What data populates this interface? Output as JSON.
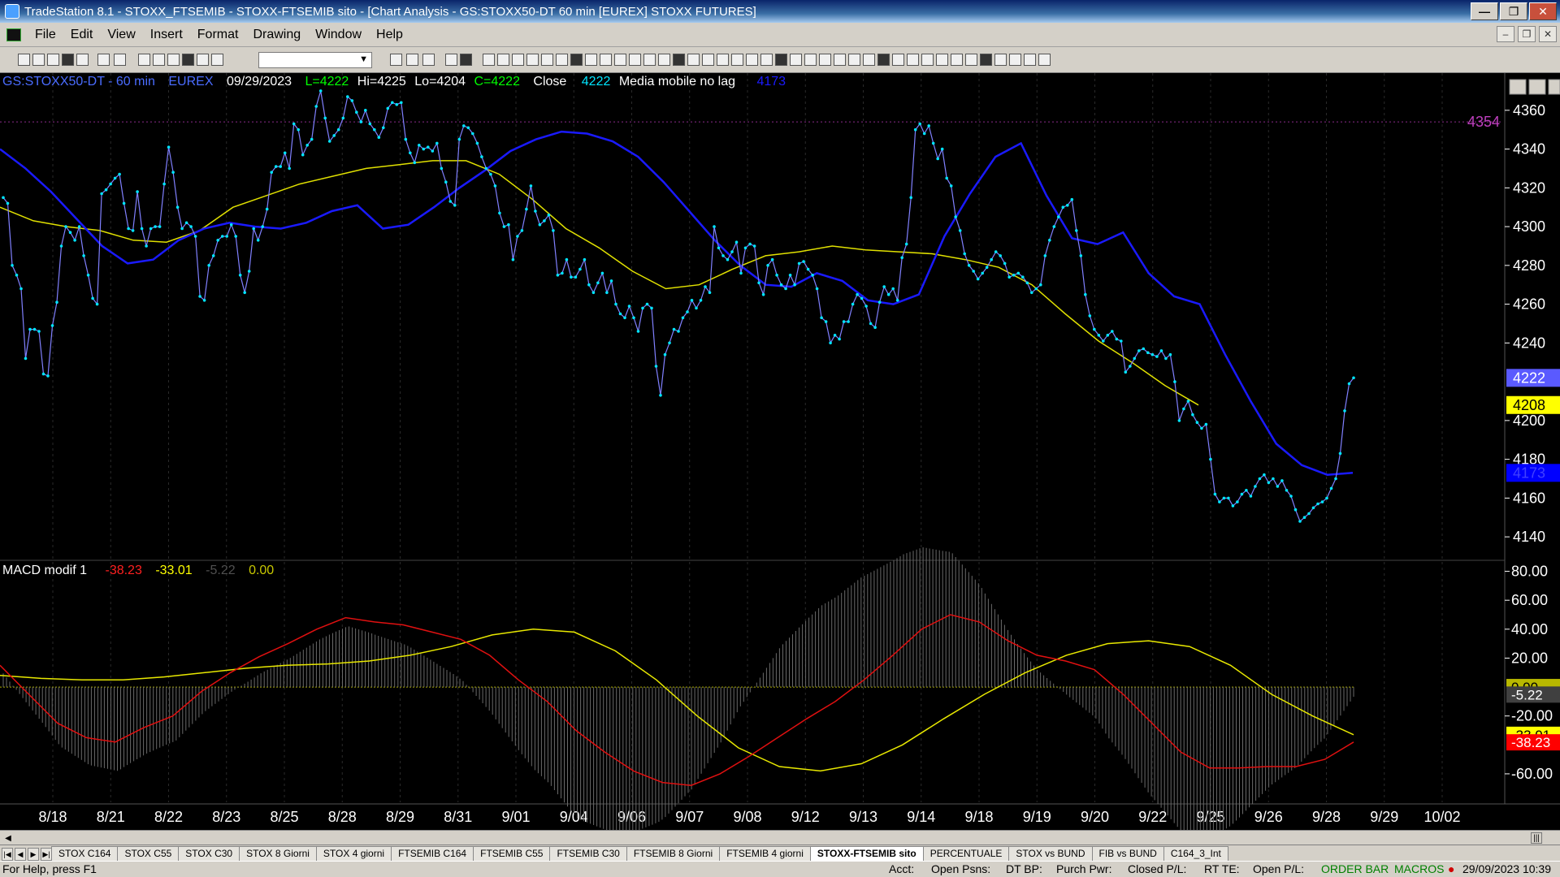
{
  "window": {
    "title": "TradeStation 8.1 - STOXX_FTSEMIB - STOXX-FTSEMIB sito - [Chart Analysis - GS:STOXX50-DT  60 min  [EUREX] STOXX FUTURES]"
  },
  "menu": [
    "File",
    "Edit",
    "View",
    "Insert",
    "Format",
    "Drawing",
    "Window",
    "Help"
  ],
  "header": {
    "symbol": "GS:STOXX50-DT - 60 min",
    "exchange": "EUREX",
    "date": "09/29/2023",
    "last": "L=4222",
    "high": "Hi=4225",
    "low": "Lo=4204",
    "close": "C=4222",
    "close_label": "Close",
    "close_value": "4222",
    "indicator_name": "Media mobile no lag",
    "indicator_value": "4173"
  },
  "macd": {
    "name": "MACD modif 1",
    "macd_value": "-38.23",
    "signal_value": "-33.01",
    "hist_value": "-5.22",
    "zero_value": "0.00"
  },
  "price_axis": {
    "ticks": [
      "4360",
      "4340",
      "4320",
      "4300",
      "4280",
      "4260",
      "4240",
      "4200",
      "4180",
      "4160",
      "4140"
    ],
    "tick_values": [
      4360,
      4340,
      4320,
      4300,
      4280,
      4260,
      4240,
      4200,
      4180,
      4160,
      4140
    ],
    "min": 4130,
    "max": 4375,
    "markers": [
      {
        "text": "4222",
        "value": 4222,
        "bg": "#5a5aff",
        "fg": "#ffffff"
      },
      {
        "text": "4208",
        "value": 4208,
        "bg": "#ffff00",
        "fg": "#000000"
      },
      {
        "text": "4173",
        "value": 4173,
        "bg": "#0000ff",
        "fg": "#4040ff"
      }
    ],
    "resistance": {
      "text": "4354",
      "value": 4354
    }
  },
  "macd_axis": {
    "ticks": [
      "80.00",
      "60.00",
      "40.00",
      "20.00",
      "-20.00",
      "-60.00"
    ],
    "tick_values": [
      80,
      60,
      40,
      20,
      -20,
      -60
    ],
    "min": -78,
    "max": 82,
    "markers": [
      {
        "text": "0.00",
        "value": 0,
        "bg": "#b8b800",
        "fg": "#000000"
      },
      {
        "text": "-5.22",
        "value": -5.22,
        "bg": "#404040",
        "fg": "#ffffff"
      },
      {
        "text": "-33.01",
        "value": -33.01,
        "bg": "#ffff00",
        "fg": "#000000"
      },
      {
        "text": "-38.23",
        "value": -38.23,
        "bg": "#ff0000",
        "fg": "#ffffff"
      }
    ]
  },
  "date_axis": [
    "8/18",
    "8/21",
    "8/22",
    "8/23",
    "8/25",
    "8/28",
    "8/29",
    "8/31",
    "9/01",
    "9/04",
    "9/06",
    "9/07",
    "9/08",
    "9/12",
    "9/13",
    "9/14",
    "9/18",
    "9/19",
    "9/20",
    "9/22",
    "9/25",
    "9/26",
    "9/28",
    "9/29",
    "10/02"
  ],
  "tabs": [
    {
      "label": "STOX C164",
      "active": false
    },
    {
      "label": "STOX C55",
      "active": false
    },
    {
      "label": "STOX  C30",
      "active": false
    },
    {
      "label": "STOX  8 Giorni",
      "active": false
    },
    {
      "label": "STOX 4 giorni",
      "active": false
    },
    {
      "label": "FTSEMIB C164",
      "active": false
    },
    {
      "label": "FTSEMIB C55",
      "active": false
    },
    {
      "label": "FTSEMIB C30",
      "active": false
    },
    {
      "label": "FTSEMIB  8 Giorni",
      "active": false
    },
    {
      "label": "FTSEMIB  4 giorni",
      "active": false
    },
    {
      "label": "STOXX-FTSEMIB sito",
      "active": true
    },
    {
      "label": "PERCENTUALE",
      "active": false
    },
    {
      "label": "STOX vs BUND",
      "active": false
    },
    {
      "label": "FIB vs BUND",
      "active": false
    },
    {
      "label": "C164_3_Int",
      "active": false
    }
  ],
  "status": {
    "help": "For Help, press F1",
    "acct": "Acct:",
    "open_psns": "Open Psns:",
    "dt_bp": "DT BP:",
    "purch_pwr": "Purch Pwr:",
    "closed_pl": "Closed P/L:",
    "rt_te": "RT TE:",
    "open_pl": "Open P/L:",
    "order_bar": "ORDER BAR",
    "macros": "MACROS",
    "datetime": "29/09/2023 10:39"
  },
  "chart_data": {
    "type": "line",
    "price_series": {
      "name": "Close",
      "values": [
        4315,
        4312,
        4280,
        4275,
        4268,
        4232,
        4247,
        4247,
        4246,
        4224,
        4223,
        4249,
        4261,
        4290,
        4300,
        4297,
        4293,
        4300,
        4285,
        4275,
        4263,
        4260,
        4317,
        4319,
        4322,
        4325,
        4327,
        4312,
        4299,
        4298,
        4318,
        4299,
        4290,
        4299,
        4300,
        4300,
        4322,
        4341,
        4328,
        4310,
        4299,
        4302,
        4300,
        4295,
        4264,
        4262,
        4280,
        4285,
        4293,
        4295,
        4295,
        4301,
        4295,
        4275,
        4266,
        4277,
        4299,
        4293,
        4300,
        4309,
        4328,
        4331,
        4331,
        4338,
        4330,
        4353,
        4350,
        4337,
        4342,
        4345,
        4362,
        4370,
        4356,
        4344,
        4347,
        4350,
        4356,
        4367,
        4365,
        4359,
        4354,
        4360,
        4353,
        4350,
        4346,
        4351,
        4361,
        4364,
        4363,
        4364,
        4345,
        4338,
        4333,
        4342,
        4340,
        4341,
        4339,
        4343,
        4330,
        4323,
        4313,
        4311,
        4345,
        4352,
        4351,
        4348,
        4343,
        4336,
        4330,
        4327,
        4321,
        4307,
        4300,
        4301,
        4283,
        4295,
        4298,
        4309,
        4321,
        4308,
        4301,
        4303,
        4306,
        4298,
        4275,
        4276,
        4283,
        4274,
        4274,
        4278,
        4283,
        4270,
        4266,
        4271,
        4276,
        4266,
        4272,
        4260,
        4255,
        4253,
        4259,
        4253,
        4246,
        4258,
        4260,
        4258,
        4228,
        4213,
        4234,
        4240,
        4247,
        4246,
        4253,
        4256,
        4262,
        4258,
        4262,
        4269,
        4266,
        4300,
        4289,
        4285,
        4283,
        4287,
        4292,
        4276,
        4289,
        4291,
        4290,
        4271,
        4265,
        4280,
        4283,
        4275,
        4270,
        4268,
        4275,
        4270,
        4281,
        4282,
        4278,
        4275,
        4268,
        4253,
        4251,
        4240,
        4244,
        4242,
        4251,
        4251,
        4260,
        4265,
        4263,
        4259,
        4250,
        4248,
        4261,
        4269,
        4265,
        4268,
        4262,
        4284,
        4291,
        4315,
        4350,
        4353,
        4348,
        4352,
        4343,
        4335,
        4340,
        4325,
        4321,
        4305,
        4298,
        4286,
        4280,
        4277,
        4273,
        4276,
        4279,
        4283,
        4287,
        4285,
        4281,
        4274,
        4275,
        4276,
        4274,
        4271,
        4266,
        4268,
        4270,
        4285,
        4293,
        4300,
        4305,
        4310,
        4311,
        4314,
        4298,
        4285,
        4265,
        4254,
        4247,
        4244,
        4241,
        4244,
        4246,
        4242,
        4241,
        4225,
        4228,
        4232,
        4236,
        4237,
        4235,
        4234,
        4233,
        4236,
        4232,
        4234,
        4220,
        4200,
        4206,
        4210,
        4203,
        4199,
        4196,
        4198,
        4180,
        4162,
        4158,
        4160,
        4160,
        4156,
        4158,
        4162,
        4164,
        4161,
        4166,
        4170,
        4172,
        4168,
        4170,
        4166,
        4169,
        4164,
        4161,
        4154,
        4148,
        4150,
        4152,
        4155,
        4157,
        4158,
        4160,
        4165,
        4170,
        4183,
        4205,
        4219,
        4222
      ]
    },
    "overlay_blue": {
      "name": "Media mobile no lag",
      "values": [
        4340,
        4330,
        4318,
        4304,
        4290,
        4281,
        4283,
        4293,
        4299,
        4302,
        4300,
        4299,
        4302,
        4308,
        4311,
        4299,
        4301,
        4310,
        4320,
        4329,
        4339,
        4345,
        4349,
        4348,
        4344,
        4336,
        4323,
        4308,
        4293,
        4280,
        4270,
        4269,
        4276,
        4272,
        4262,
        4260,
        4265,
        4295,
        4317,
        4336,
        4343,
        4316,
        4294,
        4291,
        4297,
        4276,
        4264,
        4260,
        4234,
        4210,
        4188,
        4177,
        4172,
        4173
      ]
    },
    "overlay_yellow": {
      "name": "",
      "values": [
        4310,
        4303,
        4300,
        4298,
        4293,
        4292,
        4298,
        4310,
        4316,
        4322,
        4326,
        4330,
        4332,
        4334,
        4334,
        4327,
        4314,
        4299,
        4289,
        4277,
        4268,
        4270,
        4278,
        4285,
        4287,
        4290,
        4288,
        4287,
        4286,
        4283,
        4279,
        4270,
        4255,
        4241,
        4230,
        4218,
        4208
      ]
    },
    "macd_line": {
      "name": "",
      "values": [
        15,
        -5,
        -25,
        -35,
        -38,
        -28,
        -20,
        -3,
        10,
        21,
        30,
        40,
        48,
        45,
        43,
        38,
        33,
        22,
        5,
        -10,
        -30,
        -45,
        -58,
        -66,
        -68,
        -60,
        -48,
        -35,
        -22,
        -10,
        5,
        22,
        40,
        50,
        45,
        32,
        22,
        18,
        12,
        -5,
        -25,
        -45,
        -56,
        -56,
        -55,
        -55,
        -50,
        -38
      ]
    },
    "signal_line": {
      "name": "",
      "values": [
        8,
        6,
        5,
        5,
        7,
        10,
        13,
        15,
        16,
        18,
        22,
        28,
        36,
        40,
        38,
        25,
        5,
        -20,
        -42,
        -55,
        -58,
        -53,
        -40,
        -22,
        -5,
        10,
        22,
        30,
        32,
        28,
        15,
        -5,
        -20,
        -33
      ]
    },
    "histogram_range": [
      -78,
      82
    ],
    "price_ylim": [
      4130,
      4375
    ],
    "macd_ylim": [
      -78,
      82
    ]
  }
}
